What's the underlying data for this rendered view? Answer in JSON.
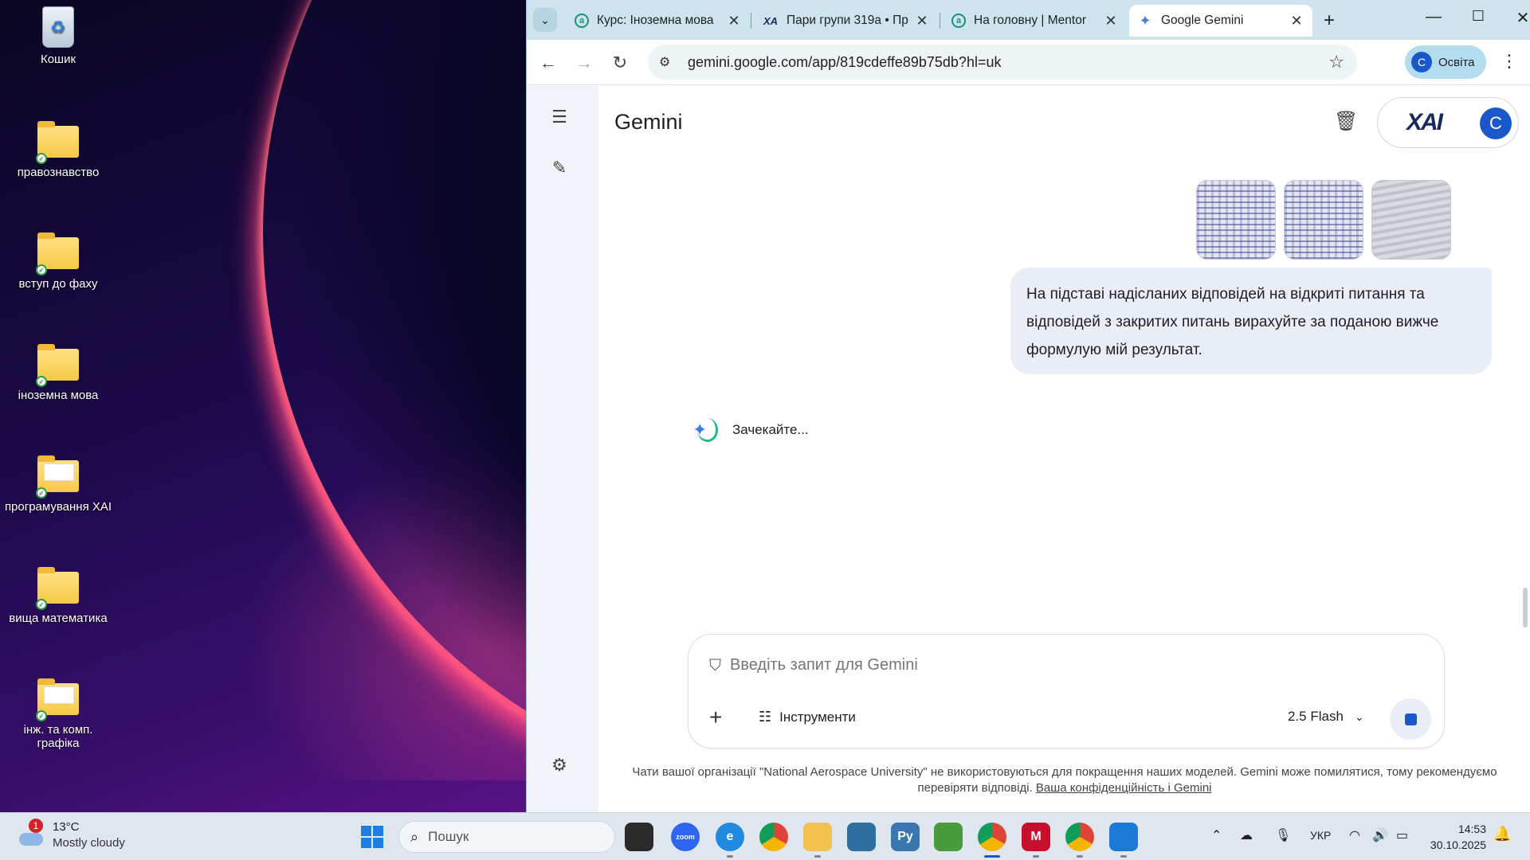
{
  "desktop": {
    "icons": [
      {
        "label": "Кошик",
        "icon": "recycle-bin-icon"
      },
      {
        "label": "правознавство",
        "icon": "folder-icon"
      },
      {
        "label": "вступ до фаху",
        "icon": "folder-icon"
      },
      {
        "label": "іноземна мова",
        "icon": "folder-icon"
      },
      {
        "label": "програмування ХАІ",
        "icon": "folder-icon"
      },
      {
        "label": "вища математика",
        "icon": "folder-icon"
      },
      {
        "label": "інж. та комп. графіка",
        "icon": "folder-icon"
      }
    ]
  },
  "browser": {
    "tabs": [
      {
        "title": "Курс: Іноземна мова",
        "favicon": "mentor-icon",
        "active": false
      },
      {
        "title": "Пари групи 319а • Пр",
        "favicon": "xai-icon",
        "active": false
      },
      {
        "title": "На головну | Mentor",
        "favicon": "mentor-icon",
        "active": false
      },
      {
        "title": "Google Gemini",
        "favicon": "gemini-icon",
        "active": true
      }
    ],
    "url": "gemini.google.com/app/819cdeffe89b75db?hl=uk",
    "profile_initial": "C",
    "profile_label": "Освіта"
  },
  "gemini": {
    "title": "Gemini",
    "account_logo": "XAI",
    "account_initial": "C",
    "user_message": "На підставі надісланих відповідей на відкриті питання та відповідей з закритих питань вирахуйте за поданою вижче формулую мій результат.",
    "loading_text": "Зачекайте...",
    "prompt_placeholder": "Введіть запит для Gemini",
    "tools_label": "Інструменти",
    "model_label": "2.5 Flash",
    "disclaimer_text": "Чати вашої організації \"National Aerospace University\" не використовуються для покращення наших моделей. Gemini може помилятися, тому рекомендуємо перевіряти відповіді.",
    "privacy_link": "Ваша конфіденційність і Gemini"
  },
  "taskbar": {
    "weather_badge": "1",
    "temperature": "13°C",
    "condition": "Mostly cloudy",
    "search_placeholder": "Пошук",
    "language": "УКР",
    "time": "14:53",
    "date": "30.10.2025"
  },
  "colors": {
    "accent": "#1a58c9",
    "tabstrip": "#cde4ef",
    "sidebar": "#f0f4f9",
    "bubble": "#e9eef6"
  }
}
